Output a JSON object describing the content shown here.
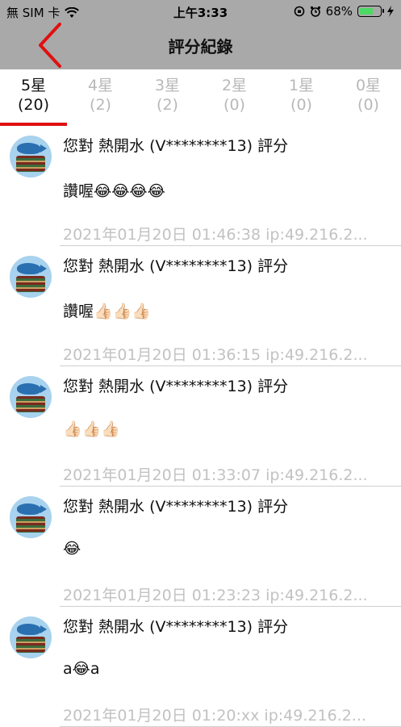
{
  "status_bar": {
    "carrier": "無 SIM 卡",
    "time": "上午3:33",
    "battery_percent": "68%",
    "battery_level": 0.68,
    "battery_color": "#4cd964"
  },
  "nav": {
    "title": "評分紀錄",
    "back_icon": "chevron-left-icon",
    "back_color": "#e01010"
  },
  "tabs": [
    {
      "label": "5星",
      "count": "(20)"
    },
    {
      "label": "4星",
      "count": "(2)"
    },
    {
      "label": "3星",
      "count": "(2)"
    },
    {
      "label": "2星",
      "count": "(0)"
    },
    {
      "label": "1星",
      "count": "(0)"
    },
    {
      "label": "0星",
      "count": "(0)"
    }
  ],
  "active_tab": 0,
  "reviews": [
    {
      "title": "您對 熱開水 (V********13) 評分",
      "content": "讚喔😂😂😂😂",
      "meta": "2021年01月20日 01:46:38 ip:49.216.2..."
    },
    {
      "title": "您對 熱開水 (V********13) 評分",
      "content": "讚喔👍🏻👍🏻👍🏻",
      "meta": "2021年01月20日 01:36:15 ip:49.216.2..."
    },
    {
      "title": "您對 熱開水 (V********13) 評分",
      "content": "👍🏻👍🏻👍🏻",
      "meta": "2021年01月20日 01:33:07 ip:49.216.2..."
    },
    {
      "title": "您對 熱開水 (V********13) 評分",
      "content": "😂",
      "meta": "2021年01月20日 01:23:23 ip:49.216.2..."
    },
    {
      "title": "您對 熱開水 (V********13) 評分",
      "content": "a😂a",
      "meta": "2021年01月20日 01:20:xx ip:49.216.2..."
    }
  ]
}
